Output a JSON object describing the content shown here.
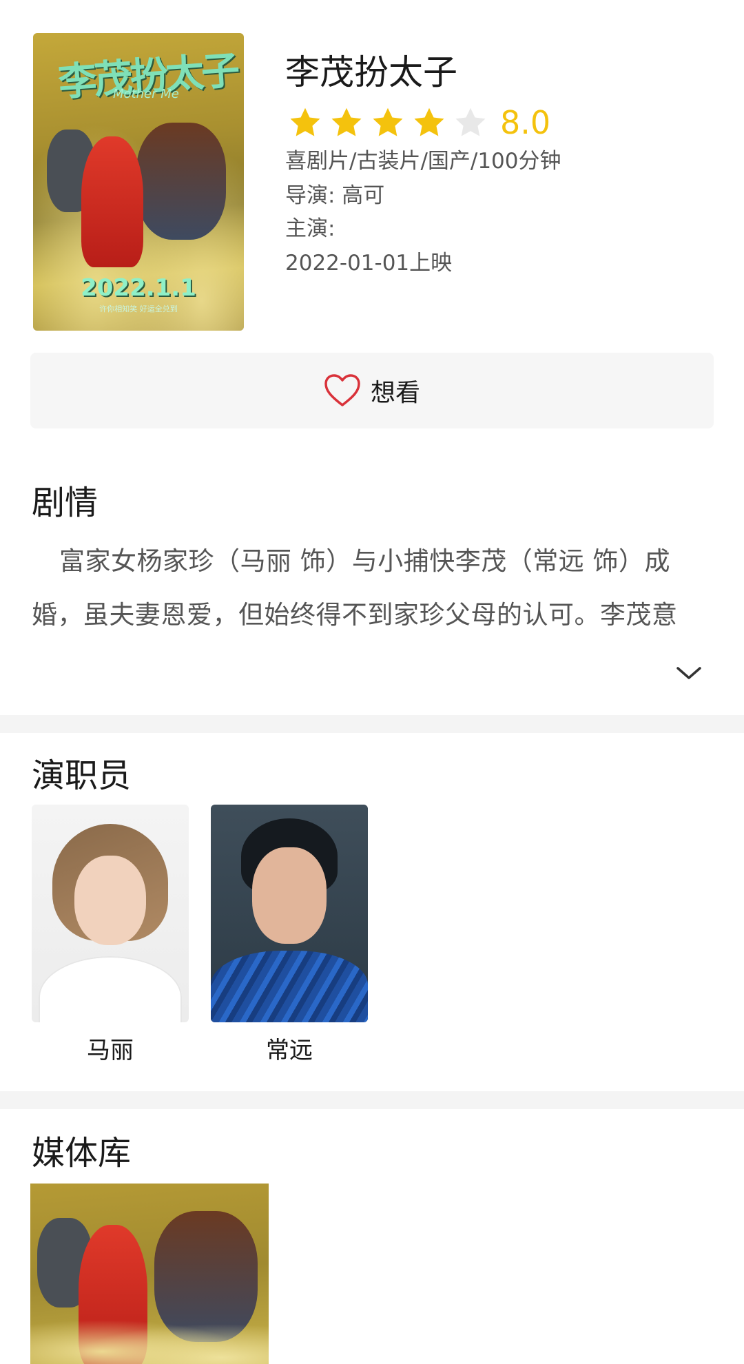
{
  "movie": {
    "title": "李茂扮太子",
    "rating": {
      "score": "8.0",
      "stars_filled": 4,
      "stars_total": 5
    },
    "genres": "喜剧片/古装片/国产/100分钟",
    "director": "导演: 高可",
    "cast_line": "主演:",
    "release": "2022-01-01上映",
    "poster": {
      "title_art": "李茂扮太子",
      "subtitle_art": "Mother Me",
      "date_art": "2022.1.1",
      "tagline_art": "许你相知笑  好运全兑到"
    }
  },
  "want_button": {
    "label": "想看",
    "icon": "heart-outline-icon"
  },
  "plot": {
    "title": "剧情",
    "text": "富家女杨家珍（马丽 饰）与小捕快李茂（常远 饰）成婚，虽夫妻恩爱，但始终得不到家珍父母的认可。李茂意"
  },
  "cast": {
    "title": "演职员",
    "members": [
      {
        "name": "马丽"
      },
      {
        "name": "常远"
      }
    ]
  },
  "media": {
    "title": "媒体库"
  },
  "colors": {
    "star_filled": "#f4c20d",
    "star_empty": "#e8e8e8",
    "score": "#f4c20d",
    "heart": "#d9323a",
    "divider": "#f4f4f4",
    "button_bg": "#f6f6f6"
  }
}
